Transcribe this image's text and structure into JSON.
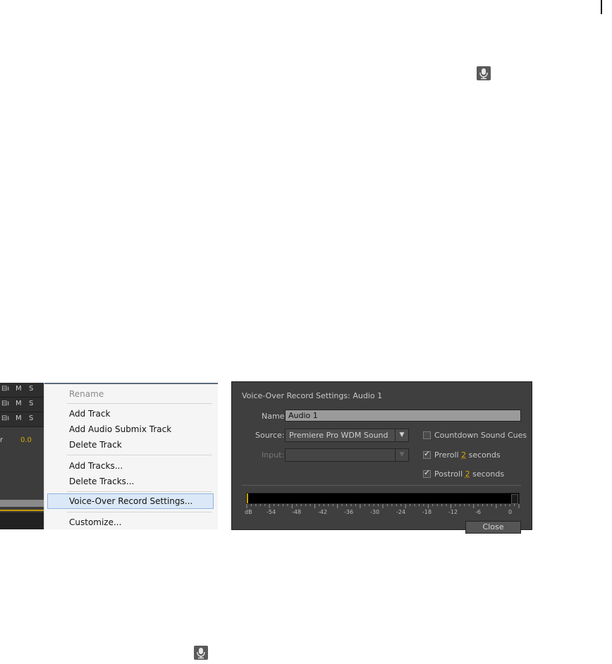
{
  "toolbar_icon": "microphone-icon",
  "tracks": {
    "rows": [
      {
        "icons": "⊟ı",
        "m": "M",
        "s": "S"
      },
      {
        "icons": "⊟ı",
        "m": "M",
        "s": "S"
      },
      {
        "icons": "⊟ı",
        "m": "M",
        "s": "S"
      }
    ],
    "value": "0.0",
    "value_prefix": "r"
  },
  "context_menu": {
    "items": [
      {
        "label": "Rename",
        "disabled": true
      },
      {
        "label": "Add Track"
      },
      {
        "label": "Add Audio Submix Track"
      },
      {
        "label": "Delete Track"
      },
      {
        "label": "Add Tracks..."
      },
      {
        "label": "Delete Tracks..."
      },
      {
        "label": "Voice-Over Record Settings...",
        "highlighted": true
      },
      {
        "label": "Customize..."
      }
    ]
  },
  "dialog": {
    "title": "Voice-Over Record Settings: Audio 1",
    "name_label": "Name:",
    "name_value": "Audio 1",
    "source_label": "Source:",
    "source_value": "Premiere Pro WDM Sound",
    "input_label": "Input:",
    "input_value": "",
    "countdown": {
      "label": "Countdown Sound Cues",
      "checked": false
    },
    "preroll": {
      "prefix": "Preroll",
      "value": "2",
      "suffix": "seconds",
      "checked": true
    },
    "postroll": {
      "prefix": "Postroll",
      "value": "2",
      "suffix": "seconds",
      "checked": true
    },
    "meter_labels": [
      "dB",
      "-54",
      "-48",
      "-42",
      "-36",
      "-30",
      "-24",
      "-18",
      "-12",
      "-6",
      "0"
    ],
    "close_label": "Close"
  },
  "colors": {
    "accent": "#d8a800",
    "dialog_bg": "#3f3f3f",
    "menu_highlight": "#dbe8f7"
  }
}
